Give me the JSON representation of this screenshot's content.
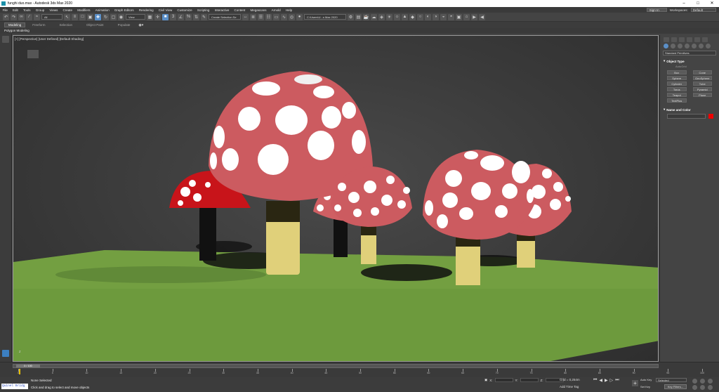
{
  "window": {
    "title": "funghi duo.max - Autodesk 3ds Max 2020",
    "controls": [
      "–",
      "□",
      "✕"
    ]
  },
  "menu": {
    "items": [
      "File",
      "Edit",
      "Tools",
      "Group",
      "Views",
      "Create",
      "Modifiers",
      "Animation",
      "Graph Editors",
      "Rendering",
      "Civil View",
      "Customize",
      "Scripting",
      "Interactive",
      "Content",
      "Megascans",
      "Arnold",
      "Help"
    ],
    "sign_in": "Sign In",
    "workspaces_label": "Workspaces:",
    "workspace_value": "Default"
  },
  "toolbar": {
    "filter_select": "All",
    "view_select": "View",
    "selection_set": "Create Selection Se",
    "project_path": "C:\\Users\\U...s Max 2020"
  },
  "ribbon": {
    "tabs": [
      "Modeling",
      "Freeform",
      "Selection",
      "Object Paint",
      "Populate"
    ],
    "panel": "Polygon Modeling"
  },
  "viewport": {
    "label": "[+] [Perspective] [User Defined] [Default Shading]",
    "axis": "z"
  },
  "command_panel": {
    "category": "Standard Primitives",
    "object_type_title": "Object Type",
    "autogrid": "AutoGrid",
    "buttons": [
      "Box",
      "Cone",
      "Sphere",
      "GeoSphere",
      "Cylinder",
      "Tube",
      "Torus",
      "Pyramid",
      "Teapot",
      "Plane",
      "TextPlus"
    ],
    "name_color_title": "Name and Color",
    "object_color": "#e00000"
  },
  "timeline": {
    "frame_label": "0 / 100",
    "ticks": [
      "0",
      "5",
      "10",
      "15",
      "20",
      "25",
      "30",
      "35",
      "40",
      "45",
      "50",
      "55",
      "60",
      "65",
      "70",
      "75",
      "80",
      "85",
      "90",
      "95",
      "100"
    ]
  },
  "status": {
    "maxscript": "Quinel Bridg",
    "line1": "None Selected",
    "line2": "Click and drag to select and move objects",
    "x_label": "X:",
    "y_label": "Y:",
    "z_label": "Z:",
    "grid": "Grid = 0,254m",
    "add_time_tag": "Add Time Tag",
    "auto_key": "Auto Key",
    "set_key": "Set Key",
    "selected_mode": "Selected",
    "key_filters": "Key Filters..."
  }
}
